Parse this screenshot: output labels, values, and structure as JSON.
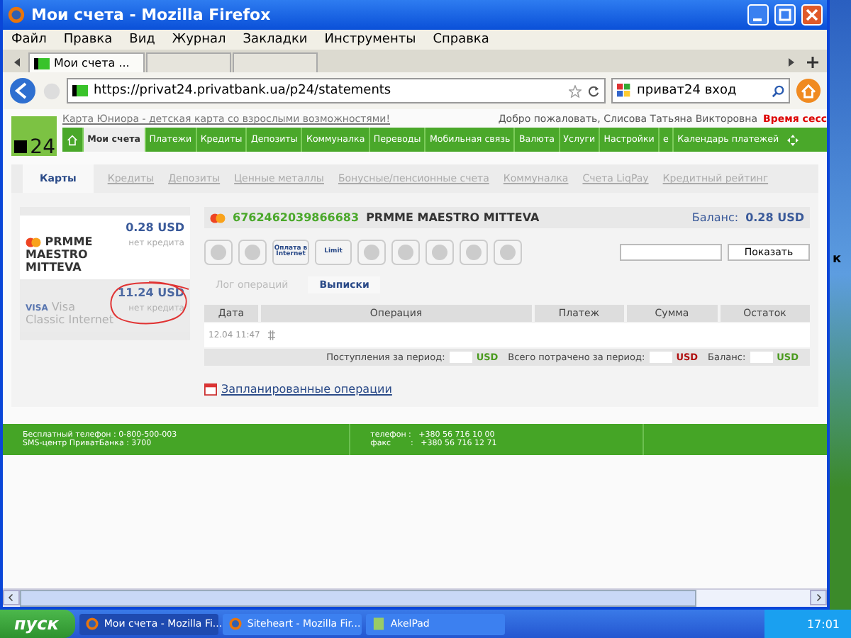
{
  "window": {
    "title": "Мои счета - Mozilla Firefox"
  },
  "menu": [
    "Файл",
    "Правка",
    "Вид",
    "Журнал",
    "Закладки",
    "Инструменты",
    "Справка"
  ],
  "browser_tabs": [
    {
      "label": "Мои счета ...",
      "selected": true
    }
  ],
  "address_bar": {
    "url": "https://privat24.privatbank.ua/p24/statements"
  },
  "search_bar": {
    "value": "приват24 вход"
  },
  "site": {
    "promo_link": "Карта Юниора - детская карта со взрослыми возможностями!",
    "welcome": "Добро пожаловать, Слисова Татьяна Викторовна",
    "session": "Время сесс",
    "logo_text": "24",
    "nav": [
      {
        "label": "Мои счета",
        "selected": true
      },
      {
        "label": "Платежи",
        "selected": false
      },
      {
        "label": "Кредиты",
        "selected": false
      },
      {
        "label": "Депозиты",
        "selected": false
      },
      {
        "label": "Коммуналка",
        "selected": false
      },
      {
        "label": "Переводы",
        "selected": false
      },
      {
        "label": "Мобильная связь",
        "selected": false
      },
      {
        "label": "Валюта",
        "selected": false
      },
      {
        "label": "Услуги",
        "selected": false
      },
      {
        "label": "Настройки",
        "selected": false
      },
      {
        "label": "е",
        "selected": false
      },
      {
        "label": "Календарь платежей",
        "selected": false
      }
    ],
    "subtabs": [
      {
        "label": "Карты",
        "selected": true
      },
      {
        "label": "Кредиты",
        "selected": false
      },
      {
        "label": "Депозиты",
        "selected": false
      },
      {
        "label": "Ценные металлы",
        "selected": false
      },
      {
        "label": "Бонусные/пенсионные счета",
        "selected": false
      },
      {
        "label": "Коммуналка",
        "selected": false
      },
      {
        "label": "Счета LiqPay",
        "selected": false
      },
      {
        "label": "Кредитный рейтинг",
        "selected": false
      }
    ]
  },
  "cards": [
    {
      "kind": "mastercard",
      "amount": "0.28 USD",
      "name": "PRMME MAESTRO MITTEVA",
      "credit": "нет кредита",
      "selected": true,
      "circled": false
    },
    {
      "kind": "visa",
      "brand": "VISA",
      "amount": "11.24 USD",
      "name": "Visa Classic Internet",
      "credit": "нет кредита",
      "selected": false,
      "circled": true
    }
  ],
  "account": {
    "number": "6762462039866683",
    "name": "PRMME MAESTRO MITTEVA",
    "balance_label": "Баланс:",
    "balance": "0.28 USD",
    "actions": [
      {
        "kind": "icon"
      },
      {
        "kind": "icon"
      },
      {
        "kind": "label",
        "label": "Оплата в Internet"
      },
      {
        "kind": "label",
        "label": "Limit"
      },
      {
        "kind": "icon"
      },
      {
        "kind": "icon"
      },
      {
        "kind": "icon"
      },
      {
        "kind": "icon"
      },
      {
        "kind": "icon"
      }
    ],
    "show_button": "Показать",
    "views": [
      {
        "label": "Лог операций",
        "selected": false
      },
      {
        "label": "Выписки",
        "selected": true
      }
    ],
    "table": {
      "columns": [
        "Дата",
        "Операция",
        "Платеж",
        "Сумма",
        "Остаток"
      ],
      "rows": [
        [
          "12.04 11:47"
        ]
      ]
    },
    "summary": [
      {
        "label": "Поступления за период:",
        "currency": "USD",
        "color": "#4a9a1e"
      },
      {
        "label": "Всего потрачено за период:",
        "currency": "USD",
        "color": "#b01010"
      },
      {
        "label": "Баланс:",
        "currency": "USD",
        "color": "#4a9a1e"
      }
    ],
    "scheduled_link": "Запланированные операции"
  },
  "footer": [
    [
      "Бесплатный телефон : 0-800-500-003",
      "SMS-центр ПриватБанка : 3700"
    ],
    [
      "телефон :   +380 56 716 10 00",
      "факс        :   +380 56 716 12 71"
    ]
  ],
  "desktop_text": "к",
  "taskbar": {
    "start": "пуск",
    "items": [
      {
        "label": "Мои счета - Mozilla Fi...",
        "selected": true,
        "kind": "firefox"
      },
      {
        "label": "Siteheart - Mozilla Fir...",
        "selected": false,
        "kind": "firefox"
      },
      {
        "label": "AkelPad",
        "selected": false,
        "kind": "notepad"
      }
    ],
    "clock": "17:01"
  }
}
